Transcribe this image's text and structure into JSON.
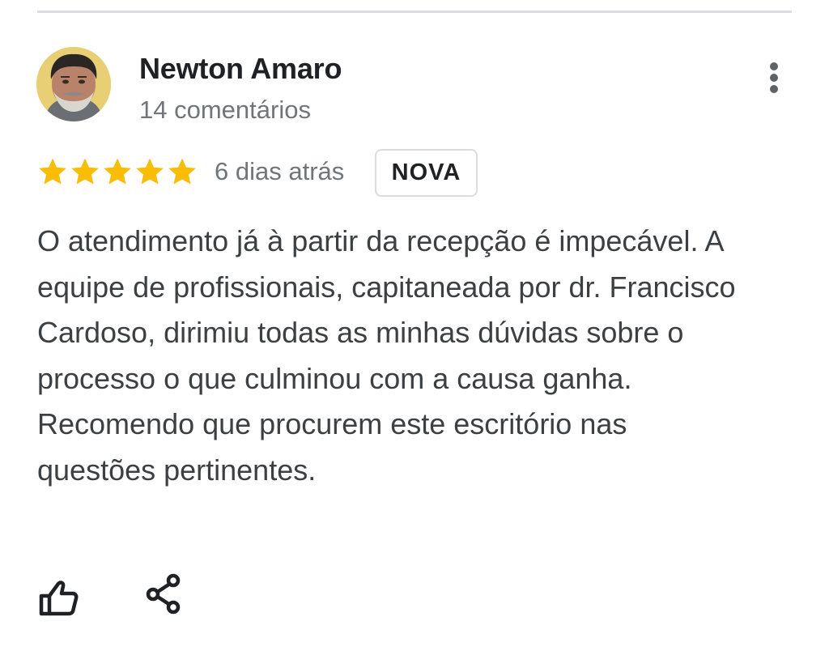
{
  "review": {
    "author": {
      "name": "Newton Amaro",
      "meta": "14 comentários",
      "avatar": "user-profile-photo"
    },
    "rating": {
      "stars": 5,
      "max": 5,
      "star_color": "#fbbc04"
    },
    "time": "6 dias atrás",
    "badge": "NOVA",
    "text": "O atendimento já à partir da recepção é impecável. A equipe de profissionais, capitaneada por dr. Francisco Cardoso, dirimiu todas as minhas dúvidas sobre o processo o que culminou com a causa ganha. Recomendo que procurem este escritório nas questões pertinentes.",
    "actions": {
      "like_icon": "thumbs-up-icon",
      "share_icon": "share-icon",
      "more_icon": "more-vertical-icon"
    }
  },
  "colors": {
    "name": "#202124",
    "secondary_text": "#70757a",
    "body_text": "#3c4043",
    "divider": "#dadce0",
    "star": "#fbbc04"
  }
}
